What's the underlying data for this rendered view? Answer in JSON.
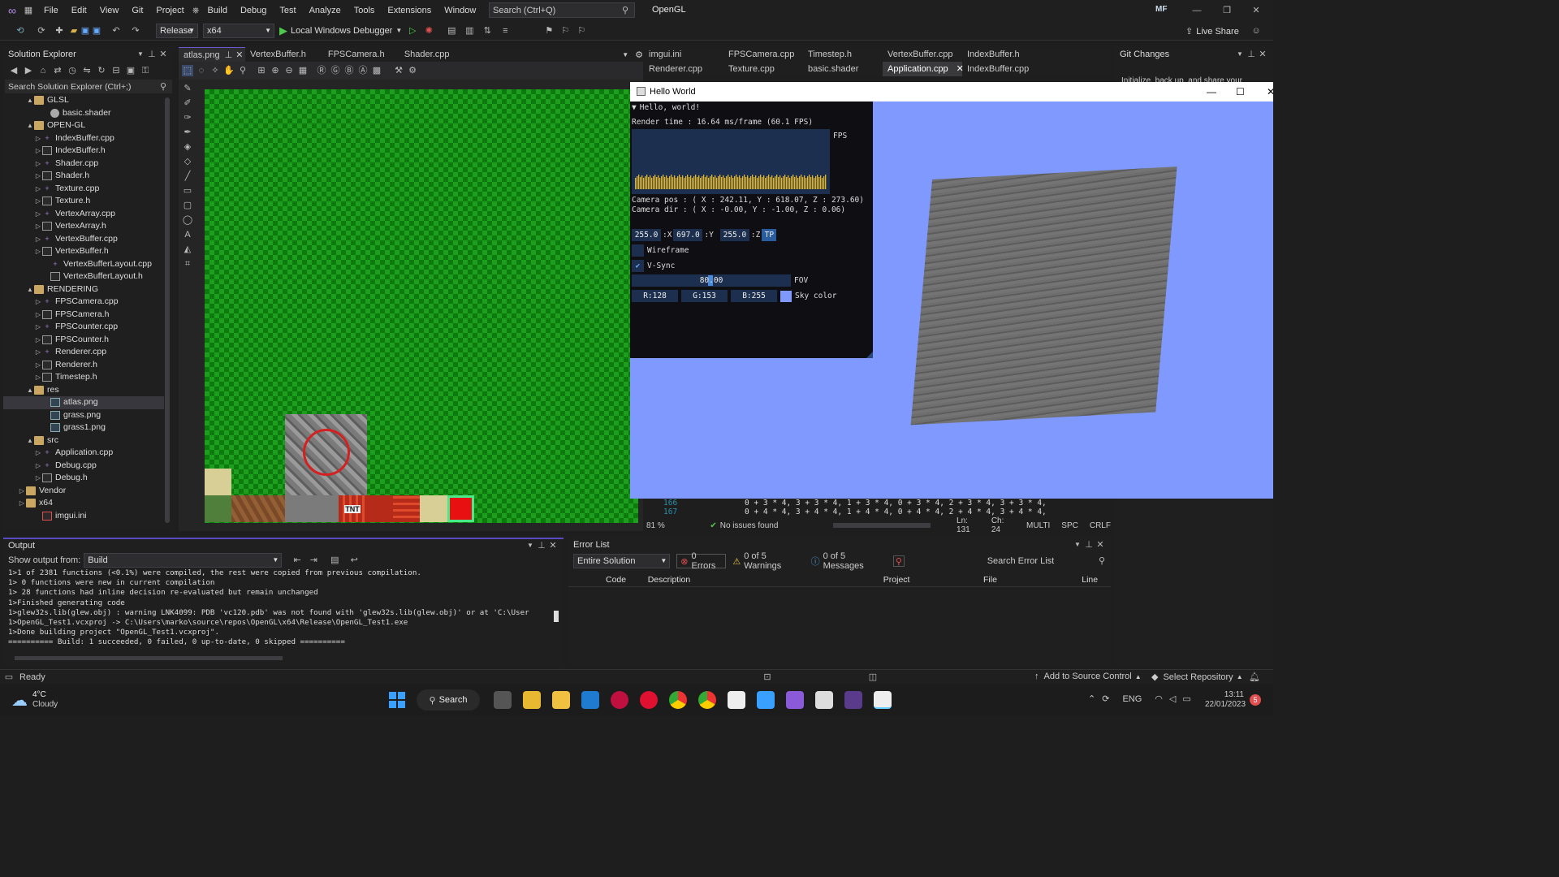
{
  "titlebar": {
    "menus": [
      "File",
      "Edit",
      "View",
      "Git",
      "Project",
      "Build",
      "Debug",
      "Test",
      "Analyze",
      "Tools",
      "Extensions",
      "Window",
      "Help"
    ],
    "search_placeholder": "Search (Ctrl+Q)",
    "app_title": "OpenGL",
    "user_initials": "MF"
  },
  "toolbar": {
    "config": "Release",
    "platform": "x64",
    "run_label": "Local Windows Debugger",
    "live_share": "Live Share"
  },
  "solution_explorer": {
    "title": "Solution Explorer",
    "search_placeholder": "Search Solution Explorer (Ctrl+;)",
    "items": [
      {
        "label": "GLSL",
        "type": "folder",
        "indent": 1,
        "arrow": "▲"
      },
      {
        "label": "basic.shader",
        "type": "shader",
        "indent": 3,
        "arrow": ""
      },
      {
        "label": "OPEN-GL",
        "type": "folder",
        "indent": 1,
        "arrow": "▲"
      },
      {
        "label": "IndexBuffer.cpp",
        "type": "cpp",
        "indent": 2,
        "arrow": "▷"
      },
      {
        "label": "IndexBuffer.h",
        "type": "h",
        "indent": 2,
        "arrow": "▷"
      },
      {
        "label": "Shader.cpp",
        "type": "cpp",
        "indent": 2,
        "arrow": "▷"
      },
      {
        "label": "Shader.h",
        "type": "h",
        "indent": 2,
        "arrow": "▷"
      },
      {
        "label": "Texture.cpp",
        "type": "cpp",
        "indent": 2,
        "arrow": "▷"
      },
      {
        "label": "Texture.h",
        "type": "h",
        "indent": 2,
        "arrow": "▷"
      },
      {
        "label": "VertexArray.cpp",
        "type": "cpp",
        "indent": 2,
        "arrow": "▷"
      },
      {
        "label": "VertexArray.h",
        "type": "h",
        "indent": 2,
        "arrow": "▷"
      },
      {
        "label": "VertexBuffer.cpp",
        "type": "cpp",
        "indent": 2,
        "arrow": "▷"
      },
      {
        "label": "VertexBuffer.h",
        "type": "h",
        "indent": 2,
        "arrow": "▷"
      },
      {
        "label": "VertexBufferLayout.cpp",
        "type": "cpp",
        "indent": 3,
        "arrow": ""
      },
      {
        "label": "VertexBufferLayout.h",
        "type": "h",
        "indent": 3,
        "arrow": ""
      },
      {
        "label": "RENDERING",
        "type": "folder",
        "indent": 1,
        "arrow": "▲"
      },
      {
        "label": "FPSCamera.cpp",
        "type": "cpp",
        "indent": 2,
        "arrow": "▷"
      },
      {
        "label": "FPSCamera.h",
        "type": "h",
        "indent": 2,
        "arrow": "▷"
      },
      {
        "label": "FPSCounter.cpp",
        "type": "cpp",
        "indent": 2,
        "arrow": "▷"
      },
      {
        "label": "FPSCounter.h",
        "type": "h",
        "indent": 2,
        "arrow": "▷"
      },
      {
        "label": "Renderer.cpp",
        "type": "cpp",
        "indent": 2,
        "arrow": "▷"
      },
      {
        "label": "Renderer.h",
        "type": "h",
        "indent": 2,
        "arrow": "▷"
      },
      {
        "label": "Timestep.h",
        "type": "h",
        "indent": 2,
        "arrow": "▷"
      },
      {
        "label": "res",
        "type": "folder",
        "indent": 1,
        "arrow": "▲"
      },
      {
        "label": "atlas.png",
        "type": "png",
        "indent": 3,
        "arrow": "",
        "selected": true
      },
      {
        "label": "grass.png",
        "type": "png",
        "indent": 3,
        "arrow": ""
      },
      {
        "label": "grass1.png",
        "type": "png",
        "indent": 3,
        "arrow": ""
      },
      {
        "label": "src",
        "type": "folder",
        "indent": 1,
        "arrow": "▲"
      },
      {
        "label": "Application.cpp",
        "type": "cpp",
        "indent": 2,
        "arrow": "▷"
      },
      {
        "label": "Debug.cpp",
        "type": "cpp",
        "indent": 2,
        "arrow": "▷"
      },
      {
        "label": "Debug.h",
        "type": "h",
        "indent": 2,
        "arrow": "▷"
      },
      {
        "label": "Vendor",
        "type": "folder",
        "indent": 0,
        "arrow": "▷"
      },
      {
        "label": "x64",
        "type": "folder",
        "indent": 0,
        "arrow": "▷"
      },
      {
        "label": "imgui.ini",
        "type": "ini",
        "indent": 2,
        "arrow": ""
      }
    ]
  },
  "editor_tabs": [
    "atlas.png",
    "VertexBuffer.h",
    "FPSCamera.h",
    "Shader.cpp"
  ],
  "right_tabs_row1": [
    "imgui.ini",
    "FPSCamera.cpp",
    "Timestep.h",
    "VertexBuffer.cpp",
    "IndexBuffer.h"
  ],
  "right_tabs_row2": [
    "Renderer.cpp",
    "Texture.cpp",
    "basic.shader",
    "Application.cpp",
    "IndexBuffer.cpp"
  ],
  "atlas": {
    "tnt_label": "TNT"
  },
  "code": {
    "line_numbers": [
      "166",
      "167"
    ],
    "lines": [
      "0 + 3 * 4, 3 + 3 * 4, 1 + 3 * 4, 0 + 3 * 4, 2 + 3 * 4, 3 + 3 * 4,",
      "0 + 4 * 4, 3 + 4 * 4, 1 + 4 * 4, 0 + 4 * 4, 2 + 4 * 4, 3 + 4 * 4,"
    ],
    "zoom": "81 %",
    "issues": "No issues found",
    "ln": "Ln: 131",
    "ch": "Ch: 24",
    "multi": "MULTI",
    "spc": "SPC",
    "crlf": "CRLF"
  },
  "hello_window": {
    "title": "Hello World",
    "imgui": {
      "header": "Hello, world!",
      "render_time": "Render time :  16.64 ms/frame (60.1 FPS)",
      "fps_label": "FPS",
      "camera_pos": "Camera pos : ( X : 242.11, Y : 618.07, Z : 273.60)",
      "camera_dir": "Camera dir : ( X : -0.00, Y : -1.00, Z : 0.06)",
      "x_val": "255.0",
      "x_label": ":X",
      "y_val": "697.0",
      "y_label": ":Y",
      "z_val": "255.0",
      "z_label": ":Z",
      "tp_button": "TP",
      "wireframe_label": "Wireframe",
      "vsync_label": "V-Sync",
      "fov_value": "80.00",
      "fov_label": "FOV",
      "r": "R:128",
      "g": "G:153",
      "b": "B:255",
      "sky_label": "Sky color",
      "sky_color": "#8099ff"
    }
  },
  "output": {
    "title": "Output",
    "show_from_label": "Show output from:",
    "source": "Build",
    "lines": [
      "1>1 of 2381 functions (<0.1%) were compiled, the rest were copied from previous compilation.",
      "1>  0 functions were new in current compilation",
      "1>  28 functions had inline decision re-evaluated but remain unchanged",
      "1>Finished generating code",
      "1>glew32s.lib(glew.obj) : warning LNK4099: PDB 'vc120.pdb' was not found with 'glew32s.lib(glew.obj)' or at 'C:\\User",
      "1>OpenGL_Test1.vcxproj -> C:\\Users\\marko\\source\\repos\\OpenGL\\x64\\Release\\OpenGL_Test1.exe",
      "1>Done building project \"OpenGL_Test1.vcxproj\".",
      "========== Build: 1 succeeded, 0 failed, 0 up-to-date, 0 skipped =========="
    ]
  },
  "error_list": {
    "title": "Error List",
    "scope": "Entire Solution",
    "errors": "0 Errors",
    "warnings": "0 of 5 Warnings",
    "messages": "0 of 5 Messages",
    "search_placeholder": "Search Error List",
    "columns": [
      "Code",
      "Description",
      "Project",
      "File",
      "Line"
    ]
  },
  "git": {
    "title": "Git Changes",
    "text": "Initialize, back up, and share your"
  },
  "status": {
    "ready": "Ready",
    "add_source": "Add to Source Control",
    "select_repo": "Select Repository"
  },
  "taskbar": {
    "weather_temp": "4°C",
    "weather_desc": "Cloudy",
    "search": "Search",
    "lang": "ENG",
    "time": "13:11",
    "date": "22/01/2023",
    "notif": "5"
  }
}
